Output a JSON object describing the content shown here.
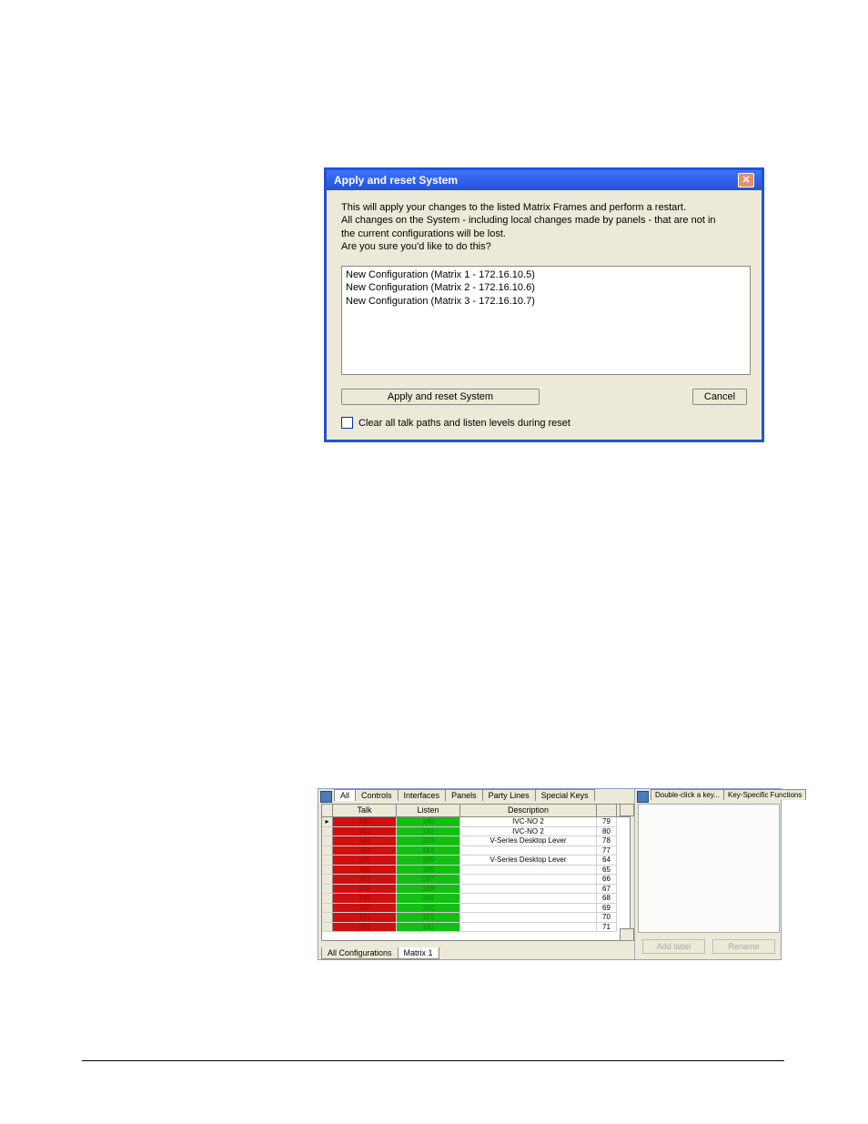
{
  "dialog1": {
    "title": "Apply and reset System",
    "text_line1": "This will apply your changes to the listed Matrix Frames and perform a restart.",
    "text_line2": "All changes on the System - including local changes made by panels - that are not in",
    "text_line3": "the current configurations will be lost.",
    "text_line4": "Are you sure you'd like to do this?",
    "list": [
      "New Configuration (Matrix 1 - 172.16.10.5)",
      "New Configuration (Matrix 2 - 172.16.10.6)",
      "New Configuration (Matrix 3 - 172.16.10.7)"
    ],
    "apply_btn": "Apply and reset System",
    "cancel_btn": "Cancel",
    "checkbox_label": "Clear all talk paths and listen levels during reset"
  },
  "panel2": {
    "tabs_top": [
      "All",
      "Controls",
      "Interfaces",
      "Panels",
      "Party Lines",
      "Special Keys"
    ],
    "headers": {
      "talk": "Talk",
      "listen": "Listen",
      "description": "Description"
    },
    "rows": [
      {
        "talk": "140",
        "listen": "140",
        "desc": "IVC-NO 2",
        "num": "79"
      },
      {
        "talk": "141",
        "listen": "141",
        "desc": "IVC-NO 2",
        "num": "80"
      },
      {
        "talk": "183",
        "listen": "183",
        "desc": "V-Series Desktop Lever",
        "num": "78"
      },
      {
        "talk": "184",
        "listen": "184",
        "desc": "",
        "num": "77"
      },
      {
        "talk": "185",
        "listen": "185",
        "desc": "V-Series Desktop Lever",
        "num": "64"
      },
      {
        "talk": "186",
        "listen": "186",
        "desc": "",
        "num": "65"
      },
      {
        "talk": "187",
        "listen": "187",
        "desc": "",
        "num": "66"
      },
      {
        "talk": "188",
        "listen": "188",
        "desc": "",
        "num": "67"
      },
      {
        "talk": "189",
        "listen": "189",
        "desc": "",
        "num": "68"
      },
      {
        "talk": "190",
        "listen": "190",
        "desc": "",
        "num": "69"
      },
      {
        "talk": "191",
        "listen": "191",
        "desc": "",
        "num": "70"
      },
      {
        "talk": "192",
        "listen": "192",
        "desc": "",
        "num": "71"
      }
    ],
    "tabs_bottom": [
      "All Configurations",
      "Matrix 1"
    ],
    "tabs_right": [
      "Double-click a key...",
      "Key-Specific Functions"
    ],
    "add_label_btn": "Add label",
    "rename_btn": "Rename"
  }
}
